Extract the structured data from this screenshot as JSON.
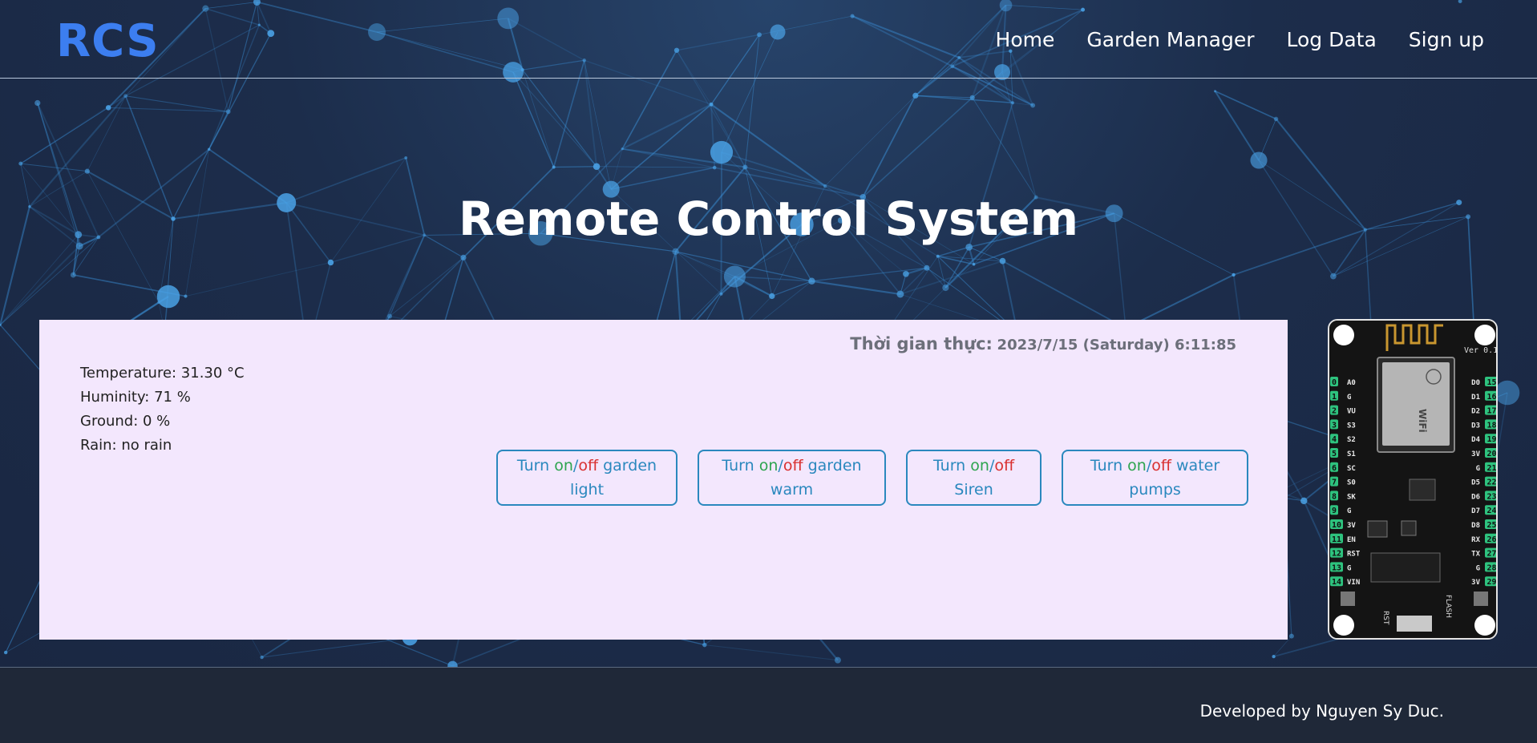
{
  "header": {
    "brand": "RCS",
    "nav": [
      {
        "label": "Home"
      },
      {
        "label": "Garden Manager"
      },
      {
        "label": "Log Data"
      },
      {
        "label": "Sign up"
      }
    ]
  },
  "hero": {
    "title": "Remote Control System"
  },
  "panel": {
    "clock_label": "Thời gian thực:",
    "clock_value": "2023/7/15 (Saturday) 6:11:85",
    "sensors": {
      "temperature": "Temperature: 31.30 °C",
      "humidity": "Huminity: 71 %",
      "ground": "Ground: 0 %",
      "rain": "Rain: no rain"
    },
    "buttons": [
      {
        "prefix": "Turn ",
        "on": "on",
        "slash": "/",
        "off": "off",
        "suffix": " garden light"
      },
      {
        "prefix": "Turn ",
        "on": "on",
        "slash": "/",
        "off": "off",
        "suffix": " garden warm"
      },
      {
        "prefix": "Turn ",
        "on": "on",
        "slash": "/",
        "off": "off",
        "suffix": " Siren"
      },
      {
        "prefix": "Turn ",
        "on": "on",
        "slash": "/",
        "off": "off",
        "suffix": " water pumps"
      }
    ]
  },
  "board": {
    "version": "Ver 0.1",
    "wifi": "WiFi",
    "left_pins": [
      "A0",
      "G",
      "VU",
      "S3",
      "S2",
      "S1",
      "SC",
      "S0",
      "SK",
      "G",
      "3V",
      "EN",
      "RST",
      "G",
      "VIN"
    ],
    "left_nums": [
      "0",
      "1",
      "2",
      "3",
      "4",
      "5",
      "6",
      "7",
      "8",
      "9",
      "10",
      "11",
      "12",
      "13",
      "14"
    ],
    "right_pins": [
      "D0",
      "D1",
      "D2",
      "D3",
      "D4",
      "3V",
      "G",
      "D5",
      "D6",
      "D7",
      "D8",
      "RX",
      "TX",
      "G",
      "3V"
    ],
    "right_nums": [
      "15",
      "16",
      "17",
      "18",
      "19",
      "20",
      "21",
      "22",
      "23",
      "24",
      "25",
      "26",
      "27",
      "28",
      "29"
    ],
    "rst": "RST",
    "flash": "FLASH"
  },
  "footer": {
    "text": "Developed by Nguyen Sy Duc."
  },
  "colors": {
    "brand": "#3c7ef0",
    "panel_bg": "#f3e7fd",
    "button": "#2a88be",
    "on": "#2ea44f",
    "off": "#d93030",
    "footer_bg": "#1f2838"
  }
}
